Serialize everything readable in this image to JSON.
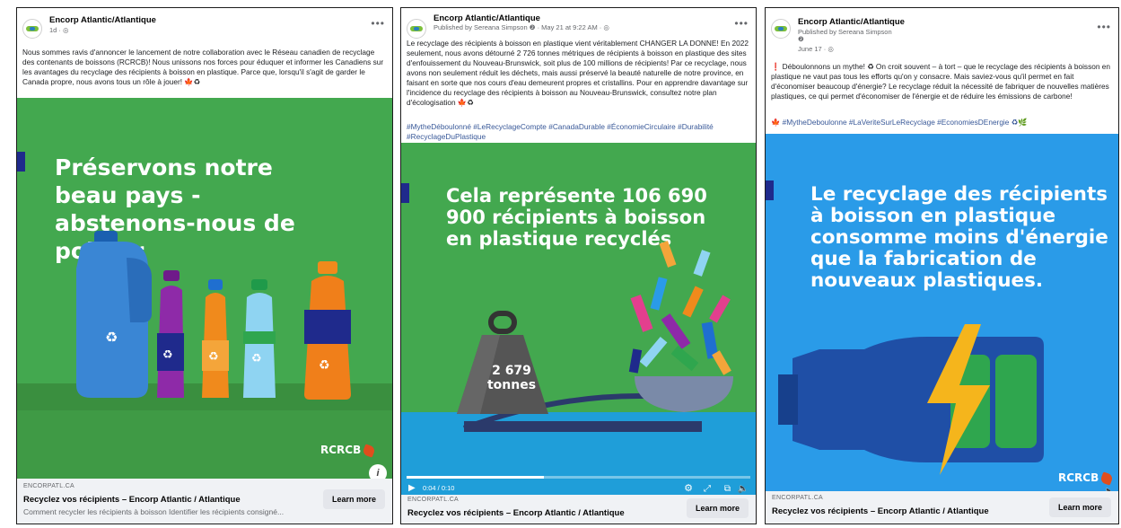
{
  "page_name": "Encorp Atlantic/Atlantique",
  "posts": [
    {
      "meta": "1d · ",
      "body": "Nous sommes ravis d'annoncer le lancement de notre collaboration avec le Réseau canadien de recyclage des contenants de boissons (RCRCB)! Nous unissons nos forces pour éduquer et informer les Canadiens sur les avantages du recyclage des récipients à boisson en plastique. Parce que, lorsqu'il s'agit de garder le Canada propre, nous avons tous un rôle à jouer! 🍁♻",
      "headline": "Préservons notre beau pays - abstenons-nous de polluer",
      "brand": "RCRCB",
      "link_domain": "ENCORPATL.CA",
      "link_title": "Recyclez vos récipients – Encorp Atlantic / Atlantique",
      "link_desc": "Comment recycler les récipients à boisson Identifier les récipients consigné...",
      "button": "Learn more",
      "info": "i"
    },
    {
      "published_by": "Published by Sereana Simpson",
      "date": "May 21 at 9:22 AM · ",
      "body": "Le recyclage des récipients à boisson en plastique vient véritablement CHANGER LA DONNE! En 2022 seulement, nous avons détourné 2 726 tonnes métriques de récipients à boisson en plastique des sites d'enfouissement du Nouveau-Brunswick, soit plus de 100 millions de récipients! Par ce recyclage, nous avons non seulement réduit les déchets, mais aussi préservé la beauté naturelle de notre province, en faisant en sorte que nos cours d'eau demeurent propres et cristallins. Pour en apprendre davantage sur l'incidence du recyclage des récipients à boisson au Nouveau-Brunswick, consultez notre plan d'écologisation 🍁♻",
      "hashtags": "#MytheDéboulonné #LeRecyclageCompte #CanadaDurable #ÉconomieCirculaire #Durabilité #RecyclageDuPlastique",
      "headline": "Cela représente 106 690 900 récipients à boisson en plastique recyclés",
      "weight_value": "2 679",
      "weight_unit": "tonnes",
      "time": "0:04 / 0:10",
      "progress": 0.4,
      "link_domain": "ENCORPATL.CA",
      "link_title": "Recyclez vos récipients – Encorp Atlantic / Atlantique",
      "button": "Learn more"
    },
    {
      "published_by": "Published by Sereana Simpson",
      "date": "June 17 · ",
      "body": "❗ Déboulonnons un mythe! ♻ On croit souvent – à tort – que le recyclage des récipients à boisson en plastique ne vaut pas tous les efforts qu'on y consacre. Mais saviez-vous qu'il permet en fait d'économiser beaucoup d'énergie? Le recyclage réduit la nécessité de fabriquer de nouvelles matières plastiques, ce qui permet d'économiser de l'énergie et de réduire les émissions de carbone!",
      "hashtags": "🍁 #MytheDeboulonne #LaVeriteSurLeRecyclage #EconomiesDEnergie ♻🌿",
      "headline": "Le recyclage des récipients à boisson en plastique consomme moins d'énergie que la fabrication de nouveaux plastiques.",
      "brand": "RCRCB",
      "link_domain": "ENCORPATL.CA",
      "link_title": "Recyclez vos récipients – Encorp Atlantic / Atlantique",
      "button": "Learn more"
    }
  ],
  "colors": {
    "green_bg": "#43a84f",
    "green_floor": "#3a8f3f",
    "blue_bg": "#2a9be8",
    "navy_bar": "#1f2a8c",
    "link_blue": "#385898"
  }
}
